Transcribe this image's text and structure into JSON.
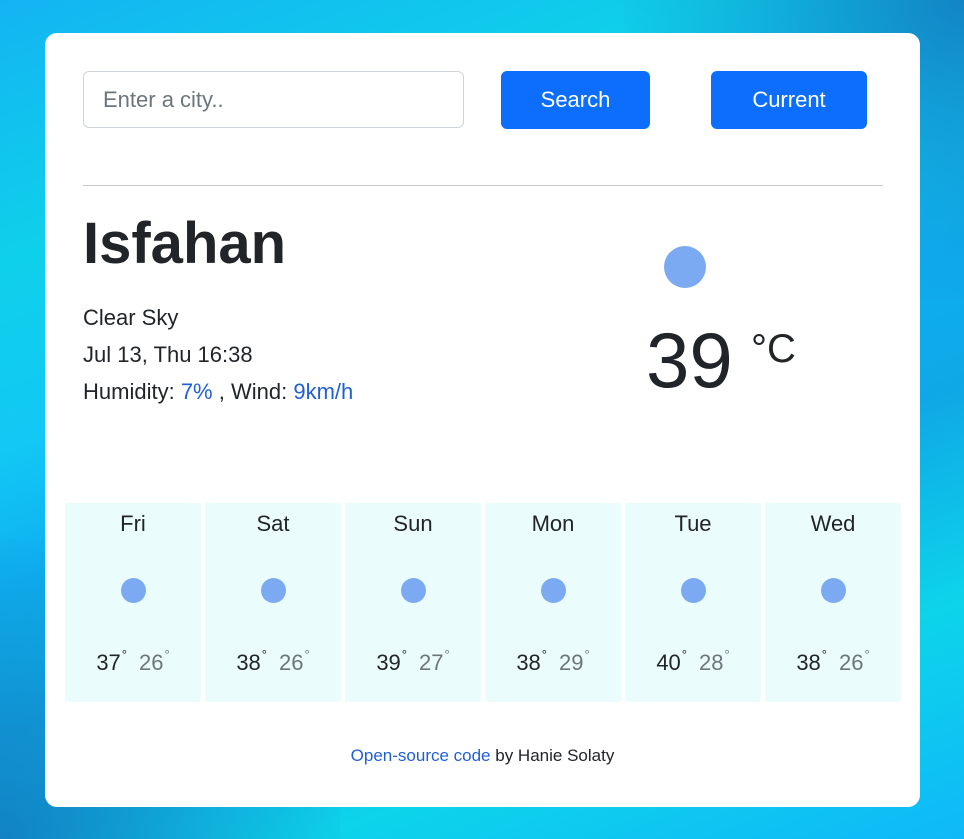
{
  "search": {
    "placeholder": "Enter a city..",
    "value": "",
    "search_label": "Search",
    "current_label": "Current"
  },
  "current": {
    "city": "Isfahan",
    "description": "Clear Sky",
    "datetime": "Jul 13, Thu 16:38",
    "humidity_label": "Humidity:",
    "humidity": "7%",
    "wind_label": ", Wind:",
    "wind": "9km/h",
    "temperature": "39",
    "unit": "°C",
    "icon": "clear-sky-icon"
  },
  "forecast": [
    {
      "day": "Fri",
      "max": "37",
      "min": "26",
      "icon": "clear-sky-icon"
    },
    {
      "day": "Sat",
      "max": "38",
      "min": "26",
      "icon": "clear-sky-icon"
    },
    {
      "day": "Sun",
      "max": "39",
      "min": "27",
      "icon": "clear-sky-icon"
    },
    {
      "day": "Mon",
      "max": "38",
      "min": "29",
      "icon": "clear-sky-icon"
    },
    {
      "day": "Tue",
      "max": "40",
      "min": "28",
      "icon": "clear-sky-icon"
    },
    {
      "day": "Wed",
      "max": "38",
      "min": "26",
      "icon": "clear-sky-icon"
    }
  ],
  "degree_symbol": "°",
  "footer": {
    "link_text": "Open-source code",
    "author_text": " by Hanie Solaty"
  },
  "colors": {
    "primary": "#0d6efd",
    "link": "#1f5fd6",
    "icon": "#7baaf2",
    "forecast_bg": "#ebfcfc"
  }
}
